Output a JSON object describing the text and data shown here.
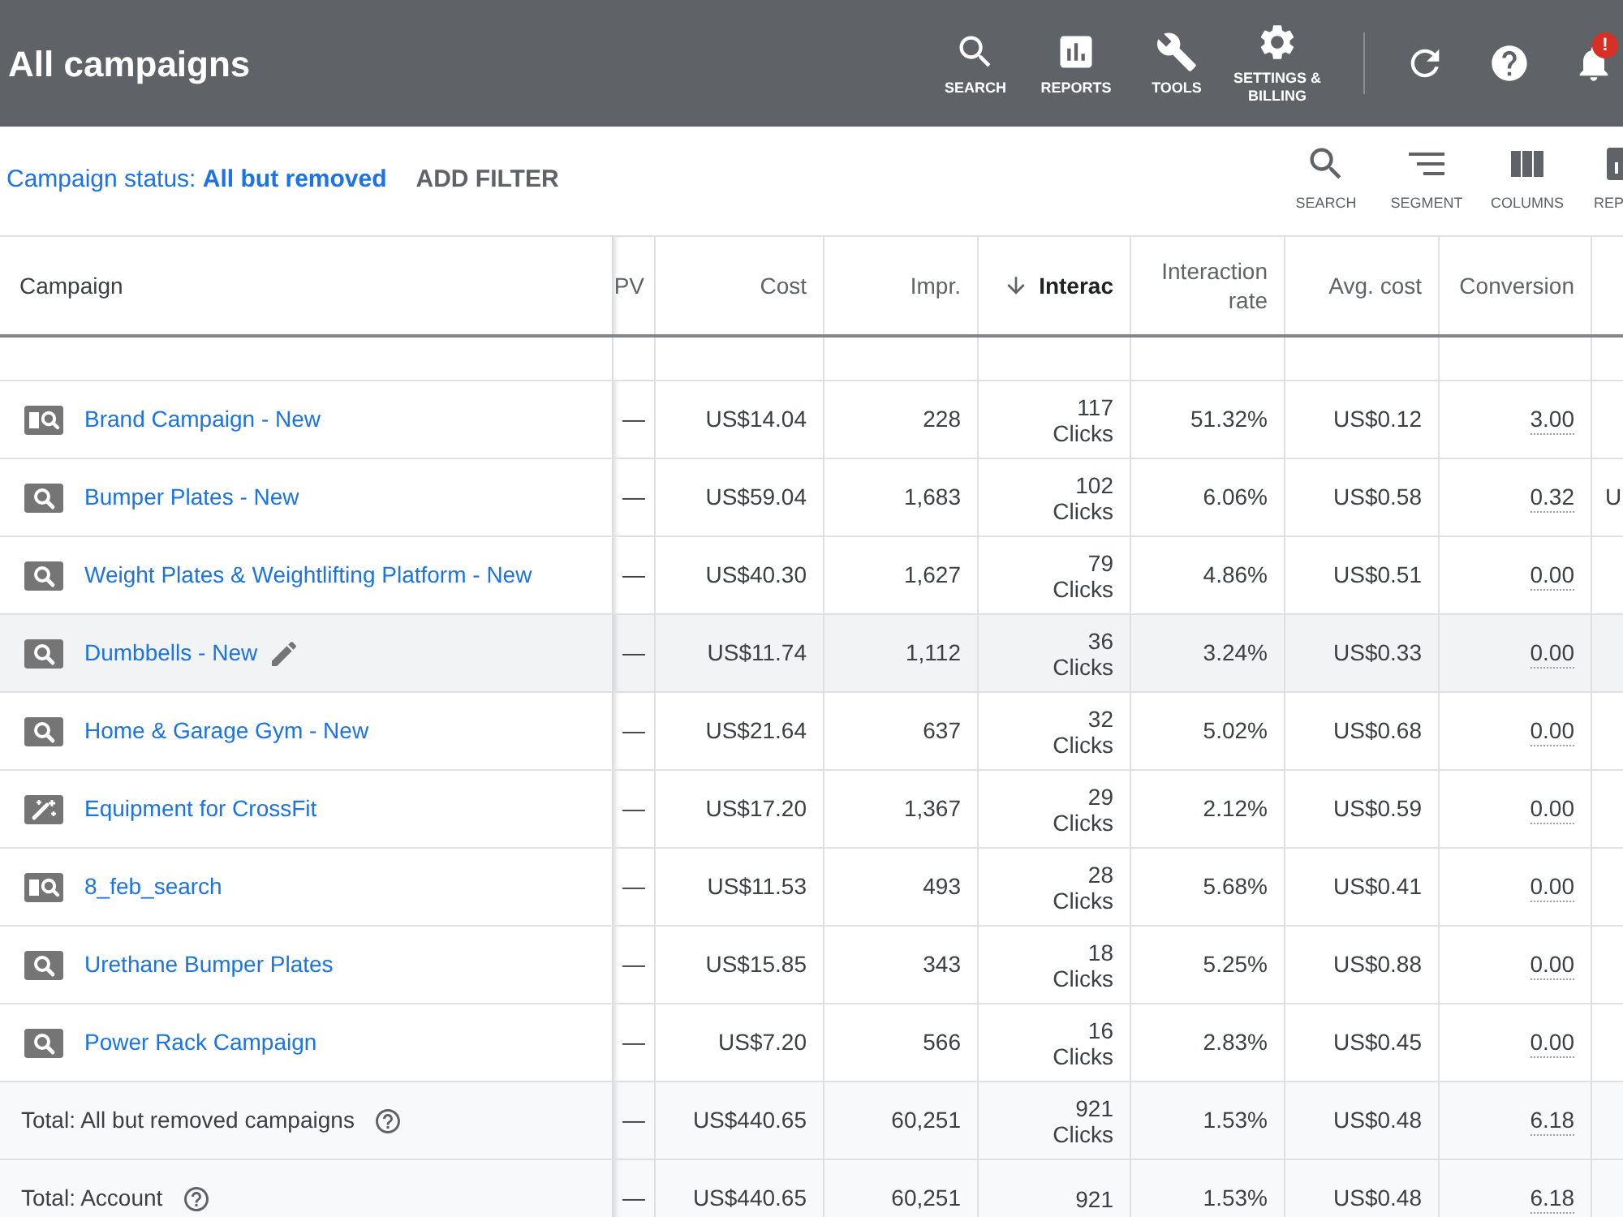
{
  "header": {
    "title": "All campaigns",
    "nav": [
      {
        "kind": "search",
        "label": "SEARCH"
      },
      {
        "kind": "reports",
        "label": "REPORTS"
      },
      {
        "kind": "tools",
        "label": "TOOLS"
      },
      {
        "kind": "settings",
        "label": "SETTINGS & BILLING"
      }
    ],
    "notification_badge": "!"
  },
  "filter_bar": {
    "status_filter": "Campaign status: **All but removed**",
    "add_filter": "ADD FILTER",
    "tools": [
      {
        "kind": "search",
        "label": "SEARCH"
      },
      {
        "kind": "segment",
        "label": "SEGMENT"
      },
      {
        "kind": "columns",
        "label": "COLUMNS"
      },
      {
        "kind": "reports",
        "label": "REP"
      }
    ]
  },
  "table": {
    "columns": [
      {
        "label": "Campaign",
        "sorted": false
      },
      {
        "label": "PV",
        "sorted": false
      },
      {
        "label": "Cost",
        "sorted": false
      },
      {
        "label": "Impr.",
        "sorted": false
      },
      {
        "label": "Interac",
        "sorted": true
      },
      {
        "label": "Interaction rate",
        "sorted": false
      },
      {
        "label": "Avg. cost",
        "sorted": false
      },
      {
        "label": "Conversion",
        "sorted": false
      }
    ],
    "rows": [
      {
        "kind": "search-split",
        "name": "Brand Campaign - New",
        "hovered": false,
        "pv": "—",
        "cost": "US$14.04",
        "impr": "228",
        "interactions": "117",
        "interaction_type": "Clicks",
        "rate": "51.32%",
        "avg_cost": "US$0.12",
        "conversions": "3.00"
      },
      {
        "kind": "search",
        "name": "Bumper Plates - New",
        "hovered": false,
        "pv": "—",
        "cost": "US$59.04",
        "impr": "1,683",
        "interactions": "102",
        "interaction_type": "Clicks",
        "rate": "6.06%",
        "avg_cost": "US$0.58",
        "conversions": "0.32",
        "column_9": "U"
      },
      {
        "kind": "search",
        "name": "Weight Plates & Weightlifting Platform - New",
        "hovered": false,
        "pv": "—",
        "cost": "US$40.30",
        "impr": "1,627",
        "interactions": "79",
        "interaction_type": "Clicks",
        "rate": "4.86%",
        "avg_cost": "US$0.51",
        "conversions": "0.00"
      },
      {
        "kind": "search",
        "name": "Dumbbells - New",
        "hovered": true,
        "pv": "—",
        "cost": "US$11.74",
        "impr": "1,112",
        "interactions": "36",
        "interaction_type": "Clicks",
        "rate": "3.24%",
        "avg_cost": "US$0.33",
        "conversions": "0.00"
      },
      {
        "kind": "search",
        "name": "Home & Garage Gym - New",
        "hovered": false,
        "pv": "—",
        "cost": "US$21.64",
        "impr": "637",
        "interactions": "32",
        "interaction_type": "Clicks",
        "rate": "5.02%",
        "avg_cost": "US$0.68",
        "conversions": "0.00"
      },
      {
        "kind": "smart",
        "name": "Equipment for CrossFit",
        "hovered": false,
        "pv": "—",
        "cost": "US$17.20",
        "impr": "1,367",
        "interactions": "29",
        "interaction_type": "Clicks",
        "rate": "2.12%",
        "avg_cost": "US$0.59",
        "conversions": "0.00"
      },
      {
        "kind": "search-split",
        "name": "8_feb_search",
        "hovered": false,
        "pv": "—",
        "cost": "US$11.53",
        "impr": "493",
        "interactions": "28",
        "interaction_type": "Clicks",
        "rate": "5.68%",
        "avg_cost": "US$0.41",
        "conversions": "0.00"
      },
      {
        "kind": "search",
        "name": "Urethane Bumper Plates",
        "hovered": false,
        "pv": "—",
        "cost": "US$15.85",
        "impr": "343",
        "interactions": "18",
        "interaction_type": "Clicks",
        "rate": "5.25%",
        "avg_cost": "US$0.88",
        "conversions": "0.00"
      },
      {
        "kind": "search",
        "name": "Power Rack Campaign",
        "hovered": false,
        "pv": "—",
        "cost": "US$7.20",
        "impr": "566",
        "interactions": "16",
        "interaction_type": "Clicks",
        "rate": "2.83%",
        "avg_cost": "US$0.45",
        "conversions": "0.00"
      }
    ],
    "totals": [
      {
        "label": "Total: All but removed campaigns",
        "pv": "—",
        "cost": "US$440.65",
        "impr": "60,251",
        "interactions": "921",
        "interaction_type": "Clicks",
        "rate": "1.53%",
        "avg_cost": "US$0.48",
        "conversions": "6.18"
      },
      {
        "label": "Total: Account",
        "pv": "—",
        "cost": "US$440.65",
        "impr": "60,251",
        "interactions": "921",
        "rate": "1.53%",
        "avg_cost": "US$0.48",
        "conversions": "6.18"
      }
    ]
  }
}
